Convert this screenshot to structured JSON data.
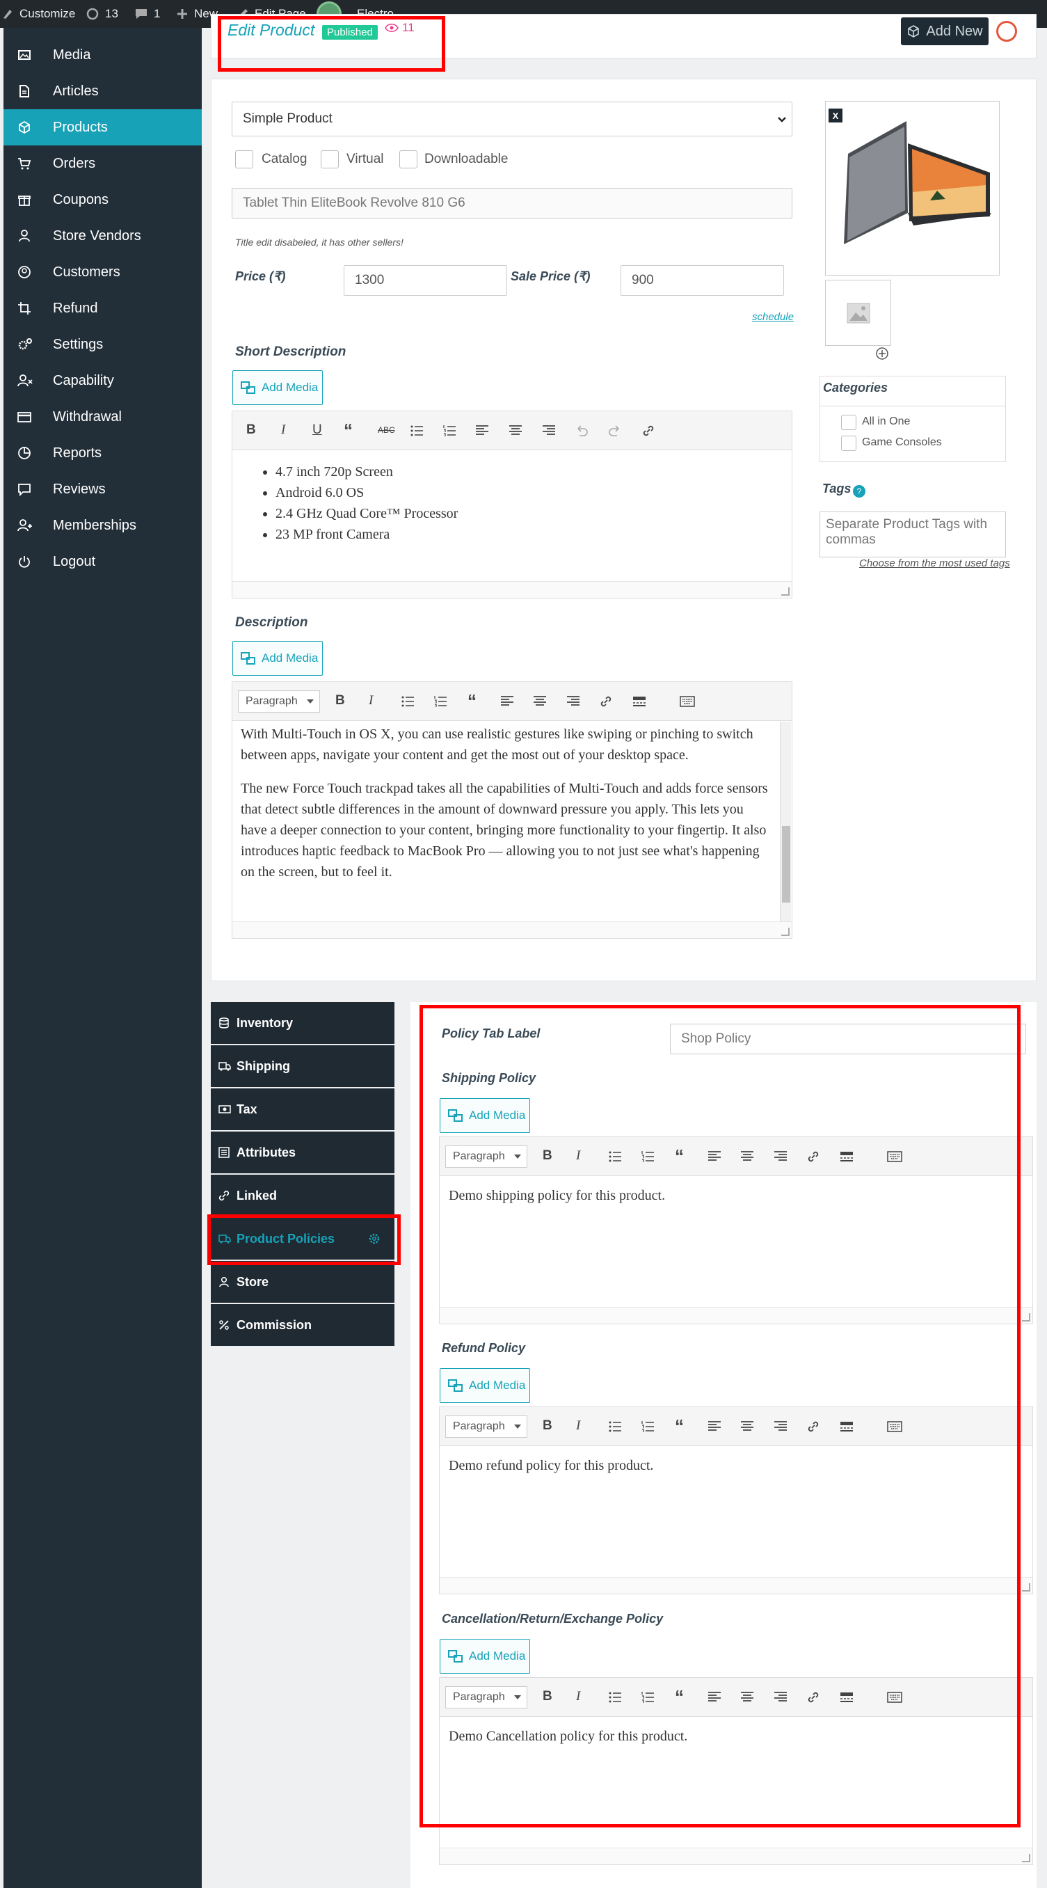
{
  "admin_bar": {
    "customize": "Customize",
    "updates": "13",
    "comments": "1",
    "new": "New",
    "edit_page": "Edit Page",
    "site": "Electro"
  },
  "sidebar": {
    "items": [
      {
        "label": "Media",
        "icon": "image-icon"
      },
      {
        "label": "Articles",
        "icon": "document-icon"
      },
      {
        "label": "Products",
        "icon": "cube-icon",
        "active": true
      },
      {
        "label": "Orders",
        "icon": "cart-icon"
      },
      {
        "label": "Coupons",
        "icon": "gift-icon"
      },
      {
        "label": "Store Vendors",
        "icon": "user-icon"
      },
      {
        "label": "Customers",
        "icon": "user-circle-icon"
      },
      {
        "label": "Refund",
        "icon": "crop-icon"
      },
      {
        "label": "Settings",
        "icon": "cogs-icon"
      },
      {
        "label": "Capability",
        "icon": "user-x-icon"
      },
      {
        "label": "Withdrawal",
        "icon": "credit-card-icon"
      },
      {
        "label": "Reports",
        "icon": "pie-chart-icon"
      },
      {
        "label": "Reviews",
        "icon": "comment-icon"
      },
      {
        "label": "Memberships",
        "icon": "user-plus-icon"
      },
      {
        "label": "Logout",
        "icon": "power-icon"
      }
    ]
  },
  "header": {
    "title": "Edit Product",
    "status": "Published",
    "views": "11",
    "add_new": "Add New"
  },
  "product": {
    "type": "Simple Product",
    "catalog": "Catalog",
    "virtual": "Virtual",
    "downloadable": "Downloadable",
    "title_value": "Tablet Thin EliteBook Revolve 810 G6",
    "title_note": "Title edit disabeled, it has other sellers!",
    "price_label": "Price (₹)",
    "price_value": "1300",
    "sale_price_label": "Sale Price (₹)",
    "sale_price_value": "900",
    "schedule": "schedule",
    "short_description_label": "Short Description",
    "short_description": [
      "4.7 inch 720p Screen",
      "Android 6.0 OS",
      "2.4 GHz Quad Core™ Processor",
      "23 MP front Camera"
    ],
    "description_label": "Description",
    "description": [
      "With Multi-Touch in OS X, you can use realistic gestures like swiping or pinching to switch between apps, navigate your content and get the most out of your desktop space.",
      "The new Force Touch trackpad takes all the capabilities of Multi-Touch and adds force sensors that detect subtle differences in the amount of downward pressure you apply. This lets you have a deeper connection to your content, bringing more functionality to your fingertip. It also introduces haptic feedback to MacBook Pro — allowing you to not just see what's happening on the screen, but to feel it."
    ],
    "add_media": "Add Media",
    "paragraph": "Paragraph",
    "image_remove": "X",
    "categories_label": "Categories",
    "categories": [
      "All in One",
      "Game Consoles"
    ],
    "tags_label": "Tags",
    "tags_placeholder": "Separate Product Tags with commas",
    "tags_link": "Choose from the most used tags"
  },
  "tabs": [
    {
      "label": "Inventory",
      "icon": "database-icon"
    },
    {
      "label": "Shipping",
      "icon": "truck-icon"
    },
    {
      "label": "Tax",
      "icon": "money-icon"
    },
    {
      "label": "Attributes",
      "icon": "list-icon"
    },
    {
      "label": "Linked",
      "icon": "link-icon"
    },
    {
      "label": "Product Policies",
      "icon": "truck-icon",
      "active": true
    },
    {
      "label": "Store",
      "icon": "user-icon"
    },
    {
      "label": "Commission",
      "icon": "percent-icon"
    }
  ],
  "policies": {
    "tab_label": "Policy Tab Label",
    "tab_value": "Shop Policy",
    "shipping_label": "Shipping Policy",
    "shipping_text": "Demo shipping policy for this product.",
    "refund_label": "Refund Policy",
    "refund_text": "Demo refund policy for this product.",
    "cancellation_label": "Cancellation/Return/Exchange Policy",
    "cancellation_text": "Demo Cancellation policy for this product."
  },
  "colors": {
    "accent": "#17a2b8",
    "sidebar": "#222e38",
    "published": "#20c997",
    "highlight": "#ff0000"
  }
}
